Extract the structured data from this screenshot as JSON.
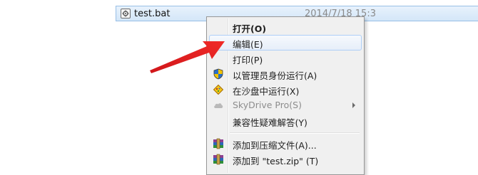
{
  "file": {
    "name": "test.bat",
    "date": "2014/7/18 15:3"
  },
  "menu": {
    "items": [
      {
        "label": "打开(O)",
        "icon": null
      },
      {
        "label": "编辑(E)",
        "icon": null
      },
      {
        "label": "打印(P)",
        "icon": null
      },
      {
        "label": "以管理员身份运行(A)",
        "icon": "uac-shield-icon"
      },
      {
        "label": "在沙盘中运行(X)",
        "icon": "sandbox-icon"
      },
      {
        "label": "SkyDrive Pro(S)",
        "icon": "cloud-icon"
      },
      {
        "label": "兼容性疑难解答(Y)",
        "icon": null
      },
      {
        "label": "添加到压缩文件(A)...",
        "icon": "winrar-archive-icon"
      },
      {
        "label": "添加到 \"test.zip\" (T)",
        "icon": "winrar-archive-icon"
      }
    ]
  },
  "colors": {
    "annotation_arrow": "#e3201f",
    "hover_border": "#aecff7",
    "selection_row": "#d4e6f8"
  }
}
